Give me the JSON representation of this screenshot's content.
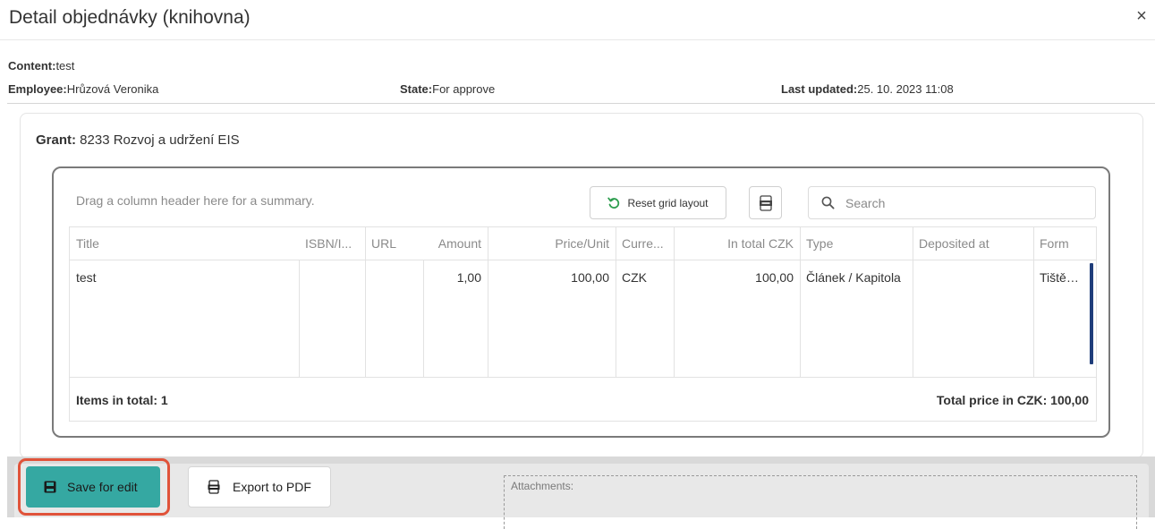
{
  "dialog": {
    "title": "Detail objednávky (knihovna)",
    "close": "×"
  },
  "info": {
    "content_label": "Content:",
    "content_value": "test",
    "employee_label": "Employee:",
    "employee_value": "Hrůzová Veronika",
    "state_label": "State:",
    "state_value": "For approve",
    "updated_label": "Last updated:",
    "updated_value": "25. 10. 2023 11:08"
  },
  "grant": {
    "label": "Grant:",
    "value": "8233 Rozvoj a udržení EIS"
  },
  "grid": {
    "group_hint": "Drag a column header here for a summary.",
    "reset_label": "Reset grid layout",
    "xlsx_icon": "excel-export-icon",
    "search_placeholder": "Search",
    "columns": [
      "Title",
      "ISBN/I...",
      "URL",
      "Amount",
      "Price/Unit",
      "Curre...",
      "In total CZK",
      "Type",
      "Deposited at",
      "Form"
    ],
    "rows": [
      [
        "test",
        "",
        "",
        "1,00",
        "100,00",
        "CZK",
        "100,00",
        "Článek / Kapitola",
        "",
        "Tištěná..."
      ]
    ],
    "footer_items": "Items in total: 1",
    "footer_total": "Total price in CZK: 100,00"
  },
  "actions": {
    "save_label": "Save for edit",
    "pdf_label": "Export to PDF",
    "attachments_label": "Attachments:"
  },
  "colors": {
    "save_button": "#35a8a2",
    "highlight": "#e0533a",
    "scroll_thumb": "#1f3d7a"
  }
}
